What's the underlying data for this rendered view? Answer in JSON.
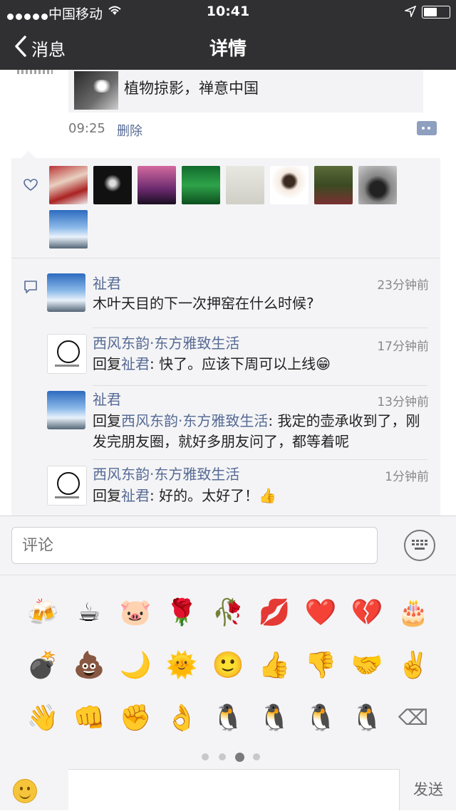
{
  "status_bar": {
    "carrier": "中国移动",
    "time": "10:41"
  },
  "nav": {
    "back_label": "消息",
    "title": "详情"
  },
  "post": {
    "share_title": "植物掠影，禅意中国",
    "time": "09:25",
    "delete_label": "删除"
  },
  "comments": [
    {
      "name": "祉君",
      "time": "23分钟前",
      "text": "木叶天目的下一次押窑在什么时候?"
    },
    {
      "name": "西风东韵·东方雅致生活",
      "time": "17分钟前",
      "reply_prefix": "回复",
      "reply_to": "祉君",
      "text": ": 快了。应该下周可以上线",
      "emoji": "😁"
    },
    {
      "name": "祉君",
      "time": "13分钟前",
      "reply_prefix": "回复",
      "reply_to": "西风东韵·东方雅致生活",
      "text": ": 我定的壶承收到了，刚发完朋友圈，就好多朋友问了，都等着呢"
    },
    {
      "name": "西风东韵·东方雅致生活",
      "time": "1分钟前",
      "reply_prefix": "回复",
      "reply_to": "祉君",
      "text": ": 好的。太好了！",
      "emoji": "👍"
    }
  ],
  "input": {
    "placeholder": "评论"
  },
  "emoji_panel": {
    "row1": [
      "🍻",
      "☕",
      "🐷",
      "🌹",
      "🥀",
      "💋",
      "❤️",
      "💔",
      "🎂"
    ],
    "row2": [
      "💣",
      "💩",
      "🌙",
      "🌞",
      "🙂",
      "👍",
      "👎",
      "🤝",
      "✌️"
    ],
    "row3": [
      "👋",
      "👊",
      "✊",
      "👌",
      "🐧",
      "🐧",
      "🐧",
      "🐧",
      "⌫"
    ],
    "page_count": 4,
    "active_page": 3
  },
  "send_label": "发送",
  "colors": {
    "nav_bg": "#303032",
    "link": "#576b95",
    "panel_bg": "#f4f4f6"
  }
}
